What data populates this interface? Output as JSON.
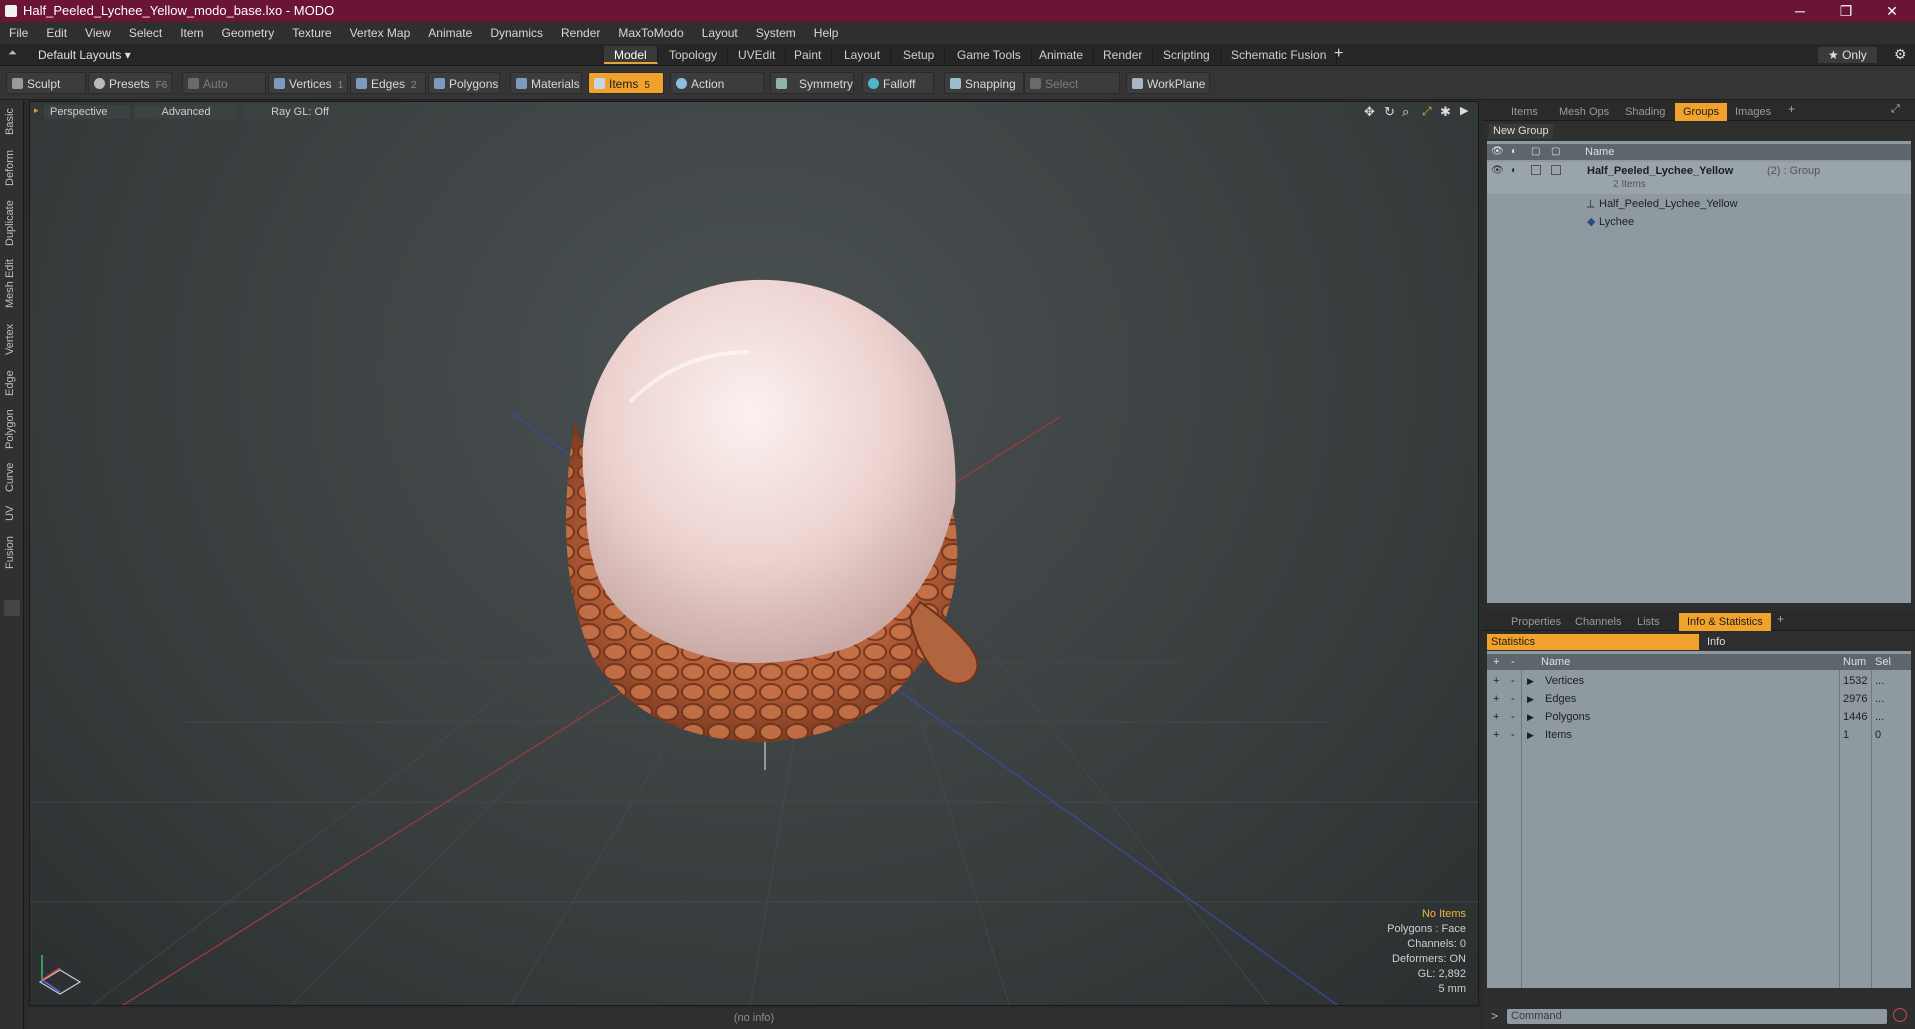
{
  "window": {
    "title": "Half_Peeled_Lychee_Yellow_modo_base.lxo - MODO",
    "minimize": "─",
    "restore": "❐",
    "close": "✕"
  },
  "menu": [
    "File",
    "Edit",
    "View",
    "Select",
    "Item",
    "Geometry",
    "Texture",
    "Vertex Map",
    "Animate",
    "Dynamics",
    "Render",
    "MaxToModo",
    "Layout",
    "System",
    "Help"
  ],
  "layoutbar": {
    "layout_label": "Default Layouts ▾",
    "tabs": [
      "Model",
      "Topology",
      "UVEdit",
      "Paint",
      "Layout",
      "Setup",
      "Game Tools",
      "Animate",
      "Render",
      "Scripting",
      "Schematic Fusion"
    ],
    "active_tab": "Model",
    "add": "+",
    "only_label": "★  Only",
    "gear": "⚙"
  },
  "toolbar": {
    "sculpt": "Sculpt",
    "presets": "Presets",
    "presets_key": "F6",
    "auto_select": "Auto Select",
    "vertices": "Vertices",
    "vertices_key": "1",
    "edges": "Edges",
    "edges_key": "2",
    "polygons": "Polygons",
    "materials": "Materials",
    "items": "Items",
    "items_key": "5",
    "action_center": "Action Center",
    "symmetry": "Symmetry",
    "falloff": "Falloff",
    "snapping": "Snapping",
    "select_through": "Select Through",
    "workplane": "WorkPlane"
  },
  "left_tabs": [
    "Basic",
    "Deform",
    "Duplicate",
    "Mesh Edit",
    "Vertex",
    "Edge",
    "Polygon",
    "Curve",
    "UV",
    "Fusion"
  ],
  "viewport": {
    "view_mode": "Perspective",
    "shading": "Advanced",
    "raygl": "Ray GL: Off",
    "info": {
      "items": "No Items",
      "polygons": "Polygons : Face",
      "channels": "Channels: 0",
      "deformers": "Deformers: ON",
      "gl": "GL: 2,892",
      "scale": "5 mm"
    }
  },
  "status": "(no info)",
  "groups_panel": {
    "tabs": [
      "Items",
      "Mesh Ops",
      "Shading",
      "Groups",
      "Images"
    ],
    "active_tab": "Groups",
    "new_group": "New Group",
    "name_header": "Name",
    "group_name": "Half_Peeled_Lychee_Yellow",
    "group_suffix": "(2) : Group",
    "group_count": "2 Items",
    "children": [
      "Half_Peeled_Lychee_Yellow",
      "Lychee"
    ]
  },
  "stats_panel": {
    "tabs": [
      "Properties",
      "Channels",
      "Lists",
      "Info & Statistics"
    ],
    "active_tab": "Info & Statistics",
    "sub_statistics": "Statistics",
    "sub_info": "Info",
    "headers": {
      "name": "Name",
      "num": "Num",
      "sel": "Sel"
    },
    "rows": [
      {
        "name": "Vertices",
        "num": "1532",
        "sel": "..."
      },
      {
        "name": "Edges",
        "num": "2976",
        "sel": "..."
      },
      {
        "name": "Polygons",
        "num": "1446",
        "sel": "..."
      },
      {
        "name": "Items",
        "num": "1",
        "sel": "0"
      }
    ]
  },
  "command": {
    "placeholder": "Command"
  },
  "colors": {
    "titlebar": "#6a1436",
    "accent": "#f0a22d",
    "panel": "#8f9aa0"
  }
}
